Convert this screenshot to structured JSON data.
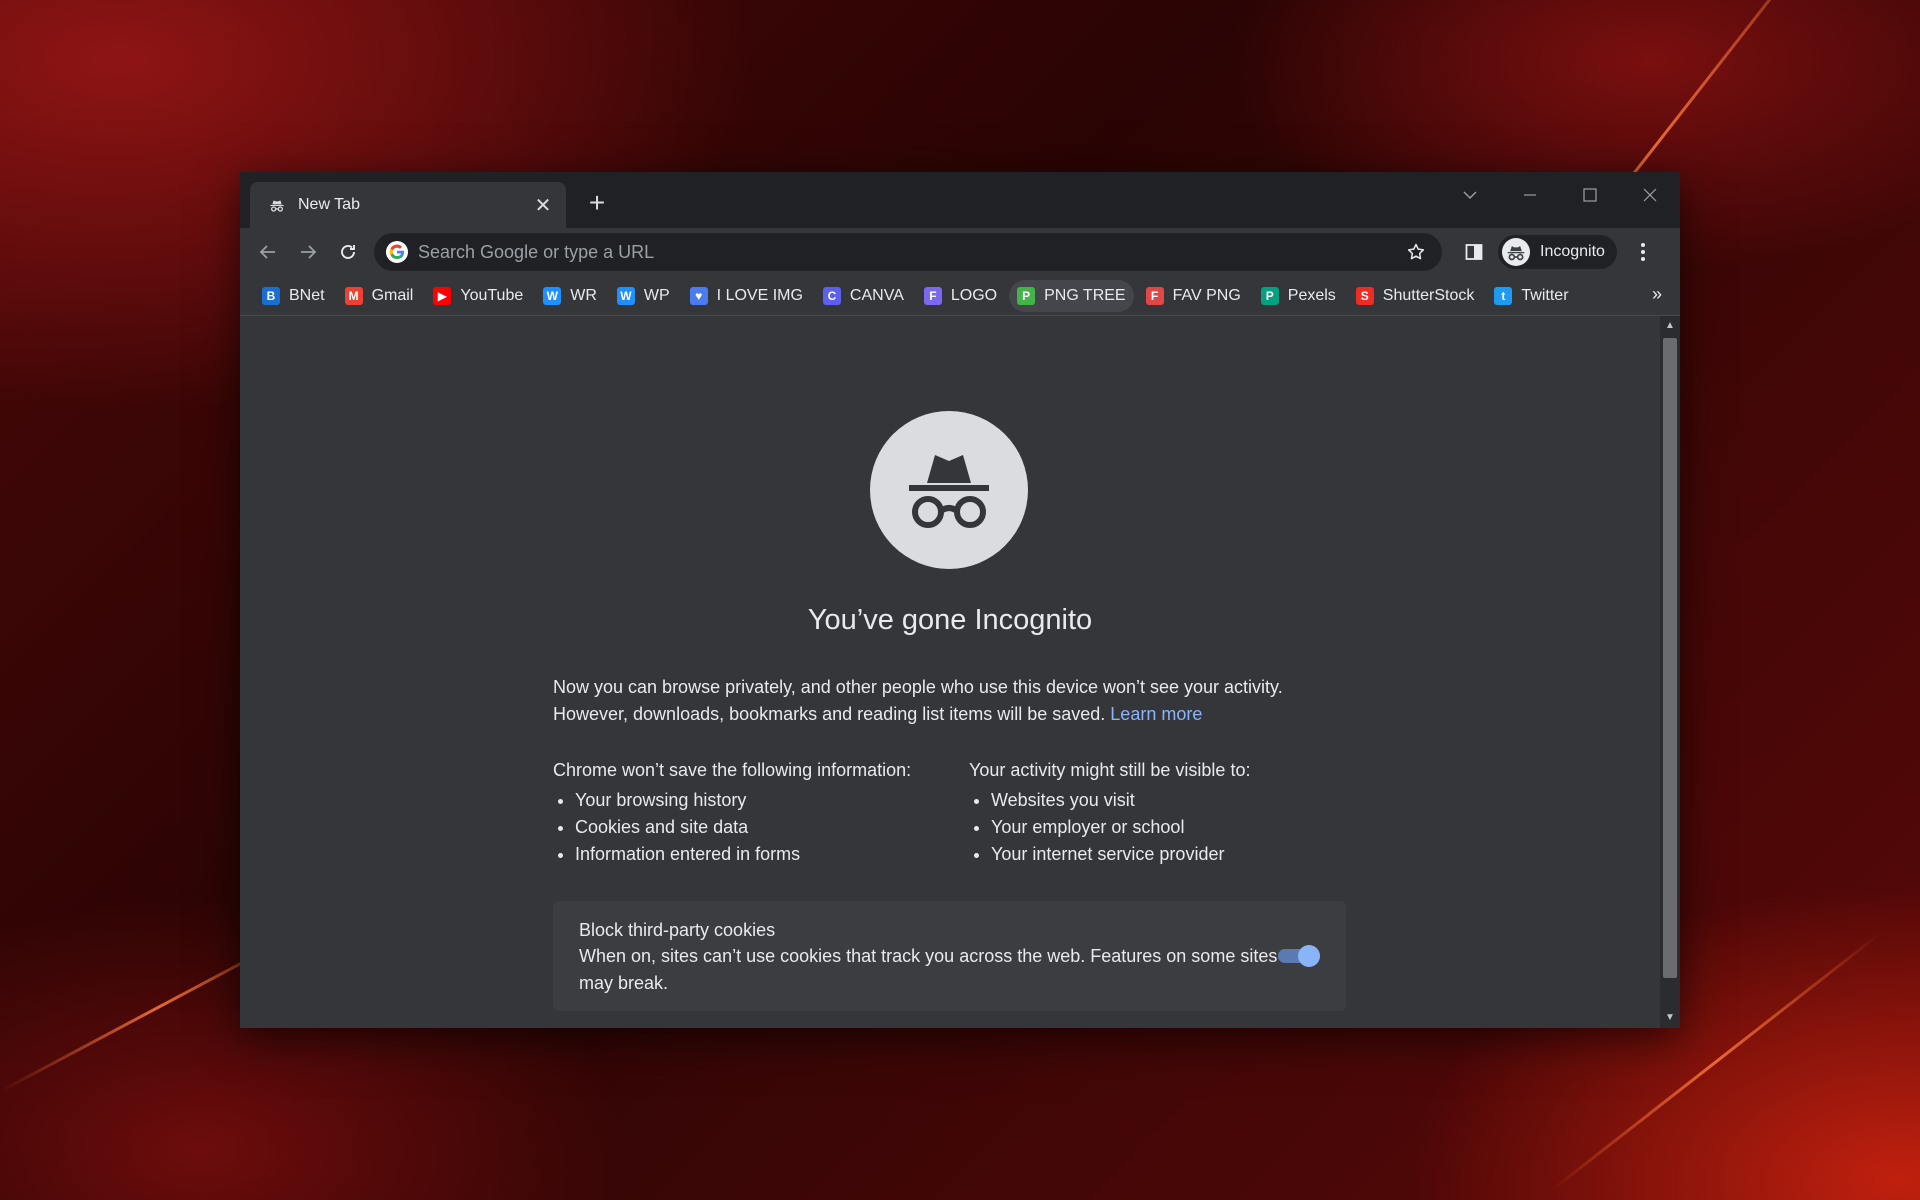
{
  "tab": {
    "title": "New Tab",
    "close_icon": "close-icon"
  },
  "omnibox": {
    "placeholder": "Search Google or type a URL"
  },
  "profile": {
    "label": "Incognito"
  },
  "bookmarks": [
    {
      "label": "BNet",
      "color": "#1b6fd1",
      "glyph": "B"
    },
    {
      "label": "Gmail",
      "color": "#ea4335",
      "glyph": "M"
    },
    {
      "label": "YouTube",
      "color": "#ff0000",
      "glyph": "▶"
    },
    {
      "label": "WR",
      "color": "#1e90ff",
      "glyph": "W"
    },
    {
      "label": "WP",
      "color": "#1e90ff",
      "glyph": "W"
    },
    {
      "label": "I LOVE IMG",
      "color": "#4a7cf0",
      "glyph": "♥"
    },
    {
      "label": "CANVA",
      "color": "#5d5fef",
      "glyph": "C"
    },
    {
      "label": "LOGO",
      "color": "#7b68ee",
      "glyph": "F"
    },
    {
      "label": "PNG TREE",
      "color": "#43b548",
      "glyph": "P"
    },
    {
      "label": "FAV PNG",
      "color": "#e04848",
      "glyph": "F"
    },
    {
      "label": "Pexels",
      "color": "#05a081",
      "glyph": "P"
    },
    {
      "label": "ShutterStock",
      "color": "#ee2b24",
      "glyph": "S"
    },
    {
      "label": "Twitter",
      "color": "#1d9bf0",
      "glyph": "t"
    }
  ],
  "bookmarks_overflow": "»",
  "page": {
    "headline": "You’ve gone Incognito",
    "intro_text": "Now you can browse privately, and other people who use this device won’t see your activity. However, downloads, bookmarks and reading list items will be saved.",
    "learn_more": "Learn more",
    "left_heading": "Chrome won’t save the following information:",
    "left_items": [
      "Your browsing history",
      "Cookies and site data",
      "Information entered in forms"
    ],
    "right_heading": "Your activity might still be visible to:",
    "right_items": [
      "Websites you visit",
      "Your employer or school",
      "Your internet service provider"
    ],
    "cookie_title": "Block third-party cookies",
    "cookie_desc": "When on, sites can’t use cookies that track you across the web. Features on some sites may break.",
    "cookie_toggle_on": true
  }
}
